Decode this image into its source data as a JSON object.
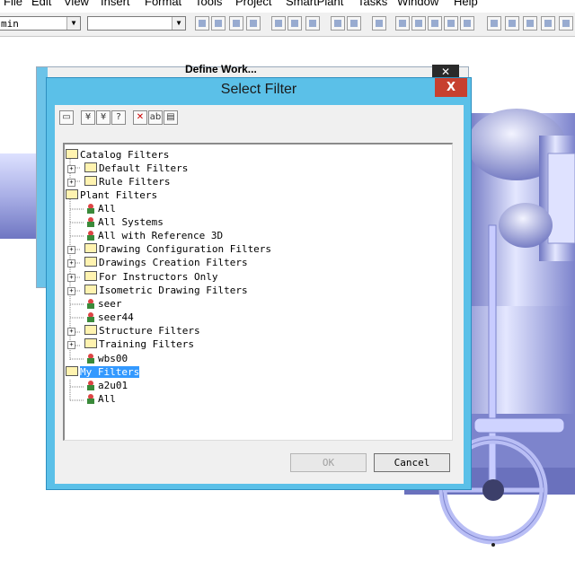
{
  "menubar": {
    "items": [
      "File",
      "Edit",
      "View",
      "Insert",
      "Format",
      "Tools",
      "Project",
      "SmartPlant",
      "Tasks",
      "Window",
      "Help"
    ]
  },
  "toolbar": {
    "combo1_value": "min",
    "combo2_value": ""
  },
  "background_window": {
    "title": "Define Work..."
  },
  "dialog": {
    "title": "Select Filter",
    "close_label": "X",
    "ok_label": "OK",
    "cancel_label": "Cancel"
  },
  "tree": {
    "rows": [
      {
        "label": "Catalog Filters",
        "kind": "folder",
        "level": 0
      },
      {
        "label": "Default Filters",
        "kind": "folder",
        "level": 1,
        "expander": "+"
      },
      {
        "label": "Rule Filters",
        "kind": "folder",
        "level": 1,
        "expander": "+"
      },
      {
        "label": "Plant Filters",
        "kind": "folder",
        "level": 0
      },
      {
        "label": "All",
        "kind": "filter",
        "level": 1
      },
      {
        "label": "All Systems",
        "kind": "filter",
        "level": 1
      },
      {
        "label": "All with Reference 3D",
        "kind": "filter",
        "level": 1
      },
      {
        "label": "Drawing Configuration Filters",
        "kind": "folder",
        "level": 1,
        "expander": "+"
      },
      {
        "label": "Drawings Creation Filters",
        "kind": "folder",
        "level": 1,
        "expander": "+"
      },
      {
        "label": "For Instructors Only",
        "kind": "folder",
        "level": 1,
        "expander": "+"
      },
      {
        "label": "Isometric Drawing Filters",
        "kind": "folder",
        "level": 1,
        "expander": "+"
      },
      {
        "label": "seer",
        "kind": "filter",
        "level": 1
      },
      {
        "label": "seer44",
        "kind": "filter",
        "level": 1
      },
      {
        "label": "Structure Filters",
        "kind": "folder",
        "level": 1,
        "expander": "+"
      },
      {
        "label": "Training Filters",
        "kind": "folder",
        "level": 1,
        "expander": "+"
      },
      {
        "label": "wbs00",
        "kind": "filter",
        "level": 1
      },
      {
        "label": "My Filters",
        "kind": "folder",
        "level": 0,
        "selected": true
      },
      {
        "label": "a2u01",
        "kind": "filter",
        "level": 1
      },
      {
        "label": "All",
        "kind": "filter",
        "level": 1
      }
    ]
  },
  "dialog_toolbar": {
    "icons": [
      "new-folder-icon",
      "new-filter-icon",
      "new-asking-filter-icon",
      "new-sql-filter-icon",
      "delete-icon",
      "rename-icon",
      "properties-icon"
    ]
  }
}
